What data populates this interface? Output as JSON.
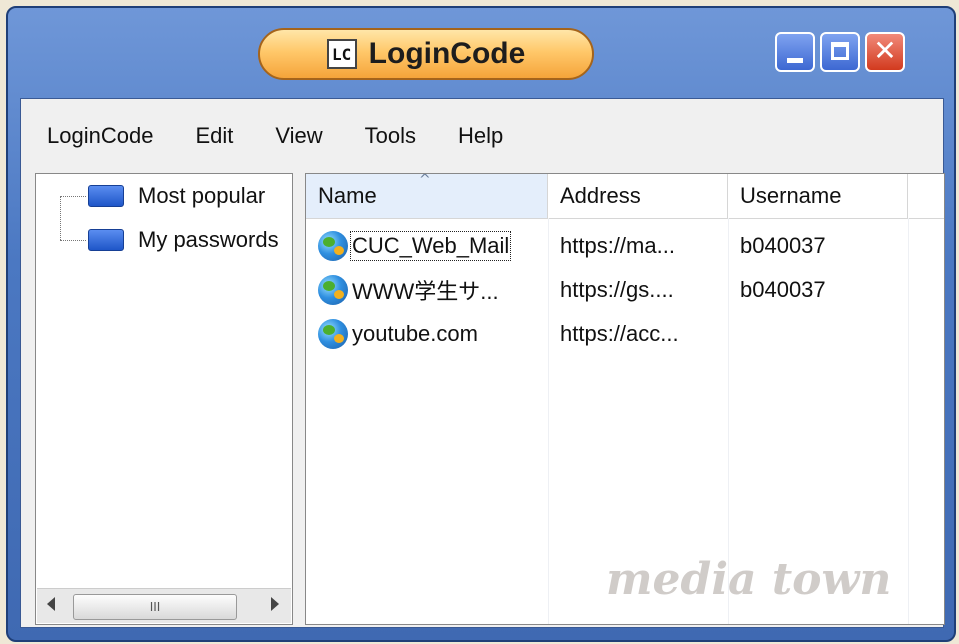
{
  "window": {
    "title": "LoginCode",
    "app_icon_text": "LC",
    "controls": {
      "minimize": "minimize",
      "maximize": "maximize",
      "close": "close"
    }
  },
  "menu": [
    "LoginCode",
    "Edit",
    "View",
    "Tools",
    "Help"
  ],
  "tree": {
    "items": [
      {
        "label": "Most popular",
        "icon": "folder-icon"
      },
      {
        "label": "My passwords",
        "icon": "folder-icon"
      }
    ],
    "scrollbar_grip": "III"
  },
  "list": {
    "sort_indicator": "^",
    "columns": [
      "Name",
      "Address",
      "Username"
    ],
    "rows": [
      {
        "name": "CUC_Web_Mail",
        "address": "https://ma...",
        "username": "b040037"
      },
      {
        "name": "WWW学生サ...",
        "address": "https://gs....",
        "username": "b040037"
      },
      {
        "name": "youtube.com",
        "address": "https://acc...",
        "username": ""
      }
    ]
  },
  "watermark": "media town",
  "colors": {
    "title_pill": "#ffc86a",
    "frame": "#4b78c2",
    "close": "#d23a1e"
  }
}
